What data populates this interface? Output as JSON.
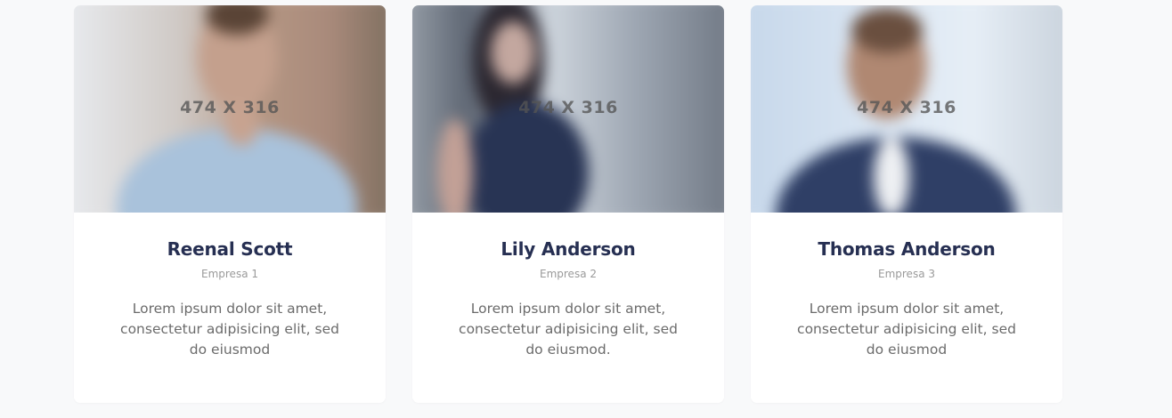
{
  "cards": [
    {
      "photo_label": "474 X 316",
      "name": "Reenal Scott",
      "company": "Empresa 1",
      "description": "Lorem ipsum dolor sit amet, consectetur adipisicing elit, sed do eiusmod"
    },
    {
      "photo_label": "474 X 316",
      "name": "Lily Anderson",
      "company": "Empresa 2",
      "description": "Lorem ipsum dolor sit amet, consectetur adipisicing elit, sed do eiusmod."
    },
    {
      "photo_label": "474 X 316",
      "name": "Thomas Anderson",
      "company": "Empresa 3",
      "description": "Lorem ipsum dolor sit amet, consectetur adipisicing elit, sed do eiusmod"
    }
  ],
  "colors": {
    "name": "#262f52",
    "company": "#9a9a9a",
    "description": "#6b6b6b",
    "page_background": "#f8f9fa",
    "card_background": "#ffffff"
  }
}
